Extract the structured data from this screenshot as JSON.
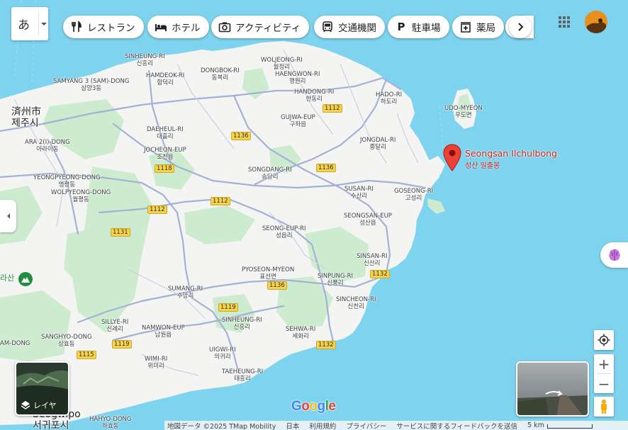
{
  "search": {
    "ime_glyph": "あ"
  },
  "chips": [
    {
      "label": "レストラン",
      "icon": "fork-knife-icon"
    },
    {
      "label": "ホテル",
      "icon": "bed-icon"
    },
    {
      "label": "アクティビティ",
      "icon": "camera-icon"
    },
    {
      "label": "交通機関",
      "icon": "bus-icon"
    },
    {
      "label": "駐車場",
      "icon": "parking-icon"
    },
    {
      "label": "薬局",
      "icon": "pharmacy-icon"
    }
  ],
  "map": {
    "places": [
      {
        "en": "SINHEUNG-RI",
        "ko": "신흥리"
      },
      {
        "en": "WOLJEONG-RI",
        "ko": "월정리"
      },
      {
        "en": "SAMYANG 3 (SAM)-DONG",
        "ko": "삼양3동"
      },
      {
        "en": "HAMDEOK-RI",
        "ko": "함덕리"
      },
      {
        "en": "DONGBOK-RI",
        "ko": "동복리"
      },
      {
        "en": "HAENGWON-RI",
        "ko": "행원리"
      },
      {
        "en": "HANDONG-RI",
        "ko": "한동리"
      },
      {
        "en": "HADO-RI",
        "ko": "하도리"
      },
      {
        "en": "UDO-MYEON",
        "ko": "우도면"
      },
      {
        "en": "GUJWA-EUP",
        "ko": "구좌읍"
      },
      {
        "en": "DAEHEUL-RI",
        "ko": "대흘리"
      },
      {
        "en": "ARA 2(I)-DONG",
        "ko": "아라이동"
      },
      {
        "en": "JOCHEON-EUP",
        "ko": "조천읍"
      },
      {
        "en": "JONGDAL-RI",
        "ko": "종달리"
      },
      {
        "en": "SONGDANG-RI",
        "ko": "송당리"
      },
      {
        "en": "YEONGPYEONG-DONG",
        "ko": "영평동"
      },
      {
        "en": "WOLPYEONG-DONG",
        "ko": "월평동"
      },
      {
        "en": "SUSAN-RI",
        "ko": "수산리"
      },
      {
        "en": "GOSEONG-RI",
        "ko": "고성리"
      },
      {
        "en": "SEONGSAN-EUP",
        "ko": "성산읍"
      },
      {
        "en": "SEONG-EUP-RI",
        "ko": "성읍리"
      },
      {
        "en": "SINSAN-RI",
        "ko": "신산리"
      },
      {
        "en": "PYOSEON-MYEON",
        "ko": "표선면"
      },
      {
        "en": "SINPUNG-RI",
        "ko": "신풍리"
      },
      {
        "en": "SUMANG-RI",
        "ko": "수망리"
      },
      {
        "en": "SINCHEON-RI",
        "ko": "신천리"
      },
      {
        "en": "SILLYE-RI",
        "ko": "신례리"
      },
      {
        "en": "NAMWON-EUP",
        "ko": "남원읍"
      },
      {
        "en": "SINHEUNG-RI",
        "ko": "신흥리"
      },
      {
        "en": "SEHWA-RI",
        "ko": "세화리"
      },
      {
        "en": "SANGHYO-DONG",
        "ko": "상효동"
      },
      {
        "en": "WIMI-RI",
        "ko": "위미리"
      },
      {
        "en": "UIGWI-RI",
        "ko": "의귀리"
      },
      {
        "en": "TAEHEUNG-RI",
        "ko": "태흥리"
      },
      {
        "en": "HAHYO-DONG",
        "ko": "하효동"
      },
      {
        "en": "AM-DONG",
        "ko": ""
      }
    ],
    "cities": [
      {
        "jp": "済州市",
        "ko": "제주시"
      },
      {
        "jp": "Seogwipo",
        "ko": "서귀포시"
      }
    ],
    "roads": [
      "1112",
      "1136",
      "1118",
      "1136",
      "1112",
      "1112",
      "1131",
      "1136",
      "1132",
      "1119",
      "1119",
      "1115",
      "1132"
    ],
    "pin": {
      "name": "Seongsan Ilchulbong",
      "ko": "성산 일출봉"
    },
    "mountain_label": "라산",
    "mountain_label2": "라산"
  },
  "layers_label": "レイヤ",
  "google_logo": "Google",
  "attribution": {
    "map_data": "地図データ ©2025 TMap Mobility",
    "country": "日本",
    "terms": "利用規約",
    "privacy": "プライバシー",
    "feedback": "サービスに関するフィードバックを送信",
    "scale": "5 km"
  },
  "colors": {
    "water": "#7ed3ee",
    "land": "#f5f5f5",
    "park": "#cdeccf",
    "road": "#9aa7cf",
    "pin": "#ea4335",
    "highway_badge": "#f6d34a"
  }
}
